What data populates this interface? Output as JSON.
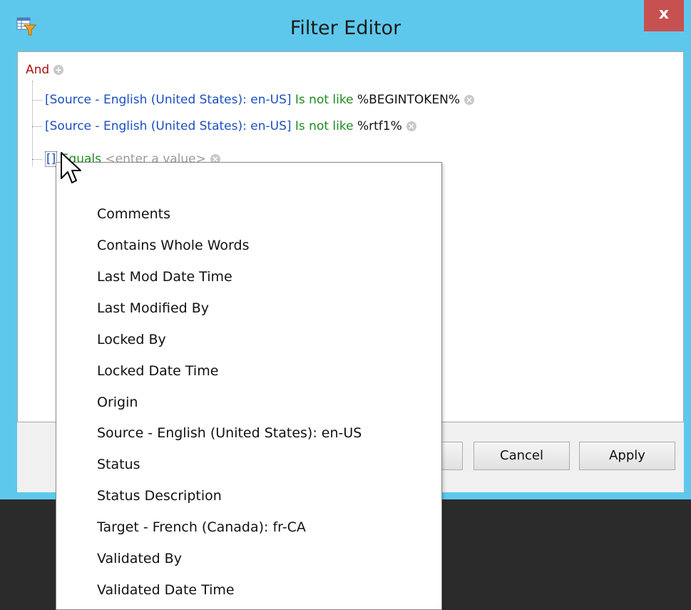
{
  "window": {
    "title": "Filter Editor",
    "close_label": "x",
    "icon": "filter-editor-icon"
  },
  "tree": {
    "root_label": "And",
    "conditions": [
      {
        "field": "[Source - English (United States): en-US]",
        "operator": "Is not like",
        "value": "%BEGINTOKEN%"
      },
      {
        "field": "[Source - English (United States): en-US]",
        "operator": "Is not like",
        "value": "%rtf1%"
      },
      {
        "field": "[]",
        "operator": "Equals",
        "value": "<enter a value>"
      }
    ]
  },
  "dropdown": {
    "items": [
      "Comments",
      "Contains Whole Words",
      "Last Mod Date Time",
      "Last Modified By",
      "Locked By",
      "Locked Date Time",
      "Origin",
      "Source - English (United States): en-US",
      "Status",
      "Status Description",
      "Target - French (Canada): fr-CA",
      "Validated By",
      "Validated Date Time"
    ]
  },
  "buttons": {
    "cancel": "Cancel",
    "apply": "Apply"
  },
  "colors": {
    "titlebar": "#5ec8ec",
    "close": "#c75050",
    "group": "#b01010",
    "field": "#1a4fc0",
    "operator": "#1f8a1f"
  }
}
